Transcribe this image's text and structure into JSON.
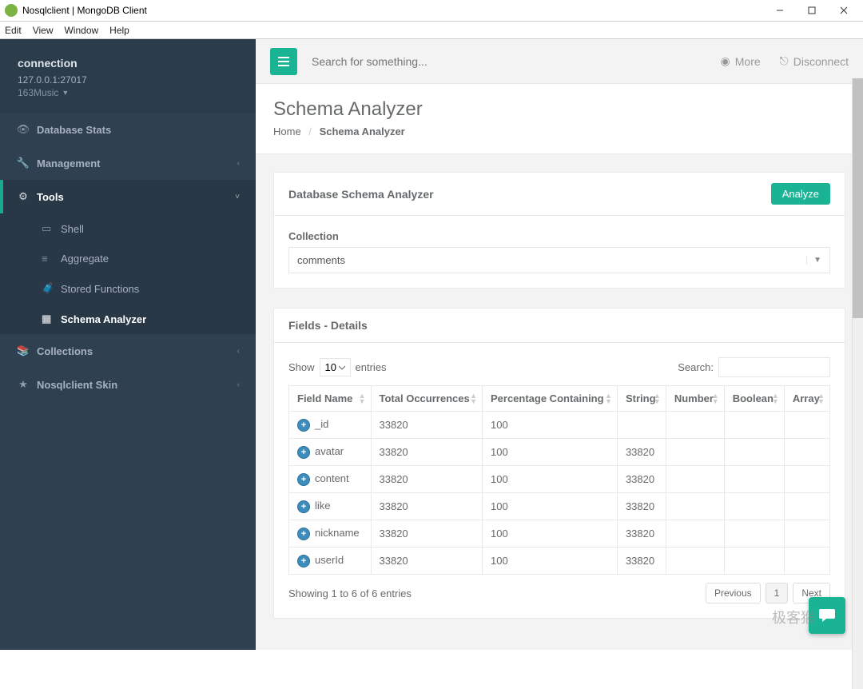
{
  "window": {
    "title": "Nosqlclient | MongoDB Client"
  },
  "menubar": [
    "Edit",
    "View",
    "Window",
    "Help"
  ],
  "sidebar": {
    "connection_label": "connection",
    "host": "127.0.0.1:27017",
    "db": "163Music",
    "items": [
      {
        "icon": "👁",
        "label": "Database Stats",
        "caret": ""
      },
      {
        "icon": "🔧",
        "label": "Management",
        "caret": "‹"
      },
      {
        "icon": "⚙",
        "label": "Tools",
        "caret": "˅",
        "active": true
      },
      {
        "icon": "📚",
        "label": "Collections",
        "caret": "‹"
      },
      {
        "icon": "★",
        "label": "Nosqlclient Skin",
        "caret": "‹"
      }
    ],
    "tools_sub": [
      {
        "icon": "▭",
        "label": "Shell"
      },
      {
        "icon": "≡",
        "label": "Aggregate"
      },
      {
        "icon": "🧳",
        "label": "Stored Functions"
      },
      {
        "icon": "▦",
        "label": "Schema Analyzer",
        "active": true
      }
    ]
  },
  "topbar": {
    "search_placeholder": "Search for something...",
    "more": "More",
    "disconnect": "Disconnect"
  },
  "page": {
    "title": "Schema Analyzer",
    "breadcrumb": {
      "home": "Home",
      "current": "Schema Analyzer"
    }
  },
  "analyzer": {
    "panel_title": "Database Schema Analyzer",
    "analyze_btn": "Analyze",
    "collection_label": "Collection",
    "collection_value": "comments"
  },
  "details": {
    "panel_title": "Fields - Details",
    "length": {
      "show": "Show",
      "value": "10",
      "entries": "entries"
    },
    "search_label": "Search:",
    "columns": [
      "Field Name",
      "Total Occurrences",
      "Percentage Containing",
      "String",
      "Number",
      "Boolean",
      "Array"
    ],
    "rows": [
      {
        "name": "_id",
        "total": "33820",
        "pct": "100",
        "string": "",
        "number": "",
        "boolean": "",
        "array": ""
      },
      {
        "name": "avatar",
        "total": "33820",
        "pct": "100",
        "string": "33820",
        "number": "",
        "boolean": "",
        "array": ""
      },
      {
        "name": "content",
        "total": "33820",
        "pct": "100",
        "string": "33820",
        "number": "",
        "boolean": "",
        "array": ""
      },
      {
        "name": "like",
        "total": "33820",
        "pct": "100",
        "string": "33820",
        "number": "",
        "boolean": "",
        "array": ""
      },
      {
        "name": "nickname",
        "total": "33820",
        "pct": "100",
        "string": "33820",
        "number": "",
        "boolean": "",
        "array": ""
      },
      {
        "name": "userId",
        "total": "33820",
        "pct": "100",
        "string": "33820",
        "number": "",
        "boolean": "",
        "array": ""
      }
    ],
    "info": "Showing 1 to 6 of 6 entries",
    "prev": "Previous",
    "page1": "1",
    "next": "Next"
  },
  "watermark": "极客猴",
  "chart_data": {
    "type": "table",
    "title": "Fields - Details",
    "columns": [
      "Field Name",
      "Total Occurrences",
      "Percentage Containing",
      "String",
      "Number",
      "Boolean",
      "Array"
    ],
    "rows": [
      [
        "_id",
        33820,
        100,
        null,
        null,
        null,
        null
      ],
      [
        "avatar",
        33820,
        100,
        33820,
        null,
        null,
        null
      ],
      [
        "content",
        33820,
        100,
        33820,
        null,
        null,
        null
      ],
      [
        "like",
        33820,
        100,
        33820,
        null,
        null,
        null
      ],
      [
        "nickname",
        33820,
        100,
        33820,
        null,
        null,
        null
      ],
      [
        "userId",
        33820,
        100,
        33820,
        null,
        null,
        null
      ]
    ]
  }
}
